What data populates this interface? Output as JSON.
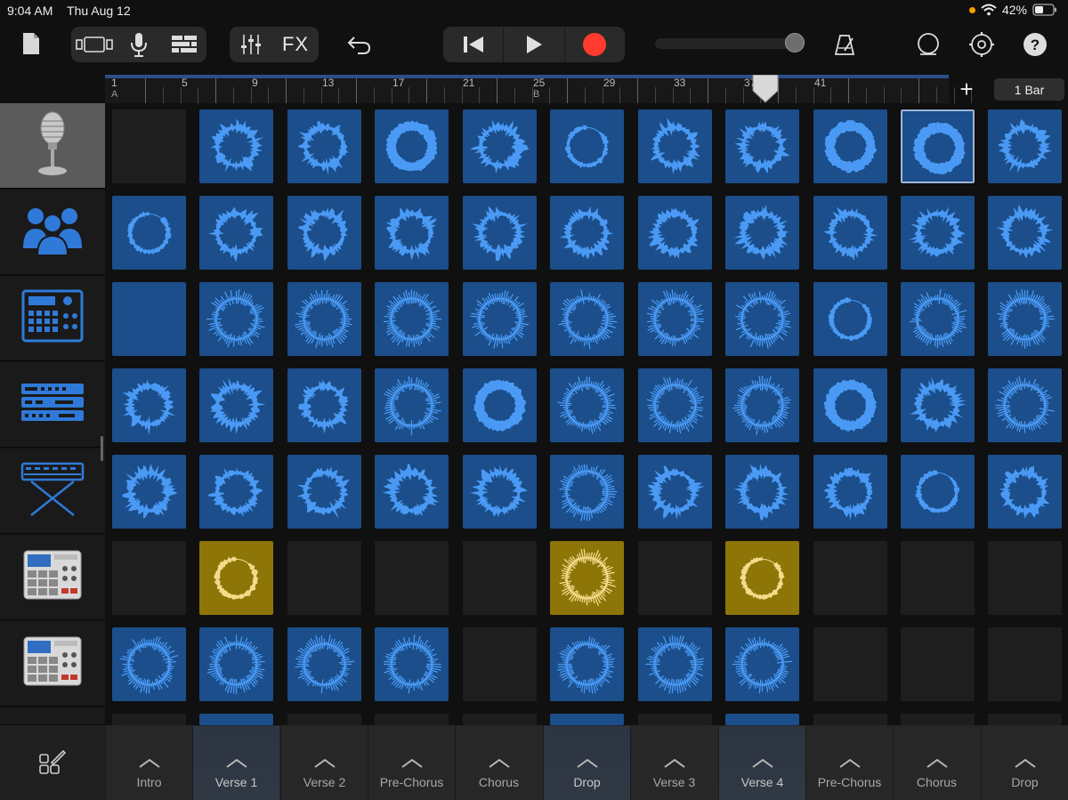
{
  "status": {
    "time": "9:04 AM",
    "date": "Thu Aug 12",
    "battery": "42%"
  },
  "toolbar": {
    "fx_label": "FX",
    "icons": [
      "document-icon",
      "view-toggle-icon",
      "microphone-icon",
      "tracks-view-icon",
      "mixer-icon",
      "undo-icon",
      "rewind-icon",
      "play-icon",
      "record-icon",
      "metronome-icon",
      "loop-icon",
      "settings-icon",
      "help-icon"
    ],
    "colors": {
      "record": "#ff3b30",
      "accent": "#2a6fdb"
    }
  },
  "ruler": {
    "bars": [
      "1",
      "5",
      "9",
      "13",
      "17",
      "21",
      "25",
      "29",
      "33",
      "37",
      "41"
    ],
    "markers": [
      {
        "bar": "1",
        "letter": "A"
      },
      {
        "bar": "25",
        "letter": "B"
      }
    ],
    "playhead_bar": "33"
  },
  "bar_length_label": "1 Bar",
  "tracks": [
    {
      "icon": "vintage-microphone-icon",
      "selected": true,
      "cells": [
        "empty",
        "blue",
        "blue",
        "blue",
        "blue",
        "blue",
        "blue",
        "blue",
        "blue",
        "blue",
        "blue"
      ],
      "wave": [
        0,
        0,
        0,
        1,
        0,
        2,
        0,
        0,
        1,
        1,
        0
      ]
    },
    {
      "icon": "singers-icon",
      "selected": false,
      "cells": [
        "blue",
        "blue",
        "blue",
        "blue",
        "blue",
        "blue",
        "blue",
        "blue",
        "blue",
        "blue",
        "blue"
      ],
      "wave": [
        2,
        0,
        0,
        0,
        0,
        0,
        0,
        0,
        0,
        0,
        0
      ]
    },
    {
      "icon": "drum-machine-icon",
      "selected": false,
      "cells": [
        "blue",
        "blue",
        "blue",
        "blue",
        "blue",
        "blue",
        "blue",
        "blue",
        "blue",
        "blue",
        "blue"
      ],
      "wave": [
        3,
        4,
        4,
        4,
        4,
        4,
        4,
        4,
        2,
        4,
        4
      ]
    },
    {
      "icon": "synth-rack-icon",
      "selected": false,
      "cells": [
        "blue",
        "blue",
        "blue",
        "blue",
        "blue",
        "blue",
        "blue",
        "blue",
        "blue",
        "blue",
        "blue"
      ],
      "wave": [
        0,
        0,
        0,
        4,
        1,
        4,
        4,
        4,
        1,
        0,
        4
      ]
    },
    {
      "icon": "keyboard-stand-icon",
      "selected": false,
      "cells": [
        "blue",
        "blue",
        "blue",
        "blue",
        "blue",
        "blue",
        "blue",
        "blue",
        "blue",
        "blue",
        "blue"
      ],
      "wave": [
        0,
        0,
        0,
        0,
        0,
        4,
        0,
        0,
        0,
        2,
        0
      ]
    },
    {
      "icon": "sampler-icon",
      "selected": false,
      "cells": [
        "empty",
        "gold",
        "empty",
        "empty",
        "empty",
        "gold",
        "empty",
        "gold",
        "empty",
        "empty",
        "empty"
      ],
      "wave": [
        3,
        2,
        3,
        3,
        3,
        4,
        3,
        2,
        3,
        3,
        3
      ]
    },
    {
      "icon": "sampler-icon",
      "selected": false,
      "cells": [
        "blue",
        "blue",
        "blue",
        "blue",
        "empty",
        "blue",
        "blue",
        "blue",
        "empty",
        "empty",
        "empty"
      ],
      "wave": [
        4,
        4,
        4,
        4,
        3,
        4,
        4,
        4,
        3,
        3,
        3
      ]
    }
  ],
  "selected_cell": {
    "row": 0,
    "col": 9
  },
  "partial_row_cells": [
    "empty",
    "blue",
    "empty",
    "empty",
    "empty",
    "blue",
    "empty",
    "blue",
    "empty",
    "empty",
    "empty"
  ],
  "sections": [
    {
      "label": "Intro",
      "playing": false
    },
    {
      "label": "Verse 1",
      "playing": true
    },
    {
      "label": "Verse 2",
      "playing": false
    },
    {
      "label": "Pre-Chorus",
      "playing": false
    },
    {
      "label": "Chorus",
      "playing": false
    },
    {
      "label": "Drop",
      "playing": true
    },
    {
      "label": "Verse 3",
      "playing": false
    },
    {
      "label": "Verse 4",
      "playing": true
    },
    {
      "label": "Pre-Chorus",
      "playing": false
    },
    {
      "label": "Chorus",
      "playing": false
    },
    {
      "label": "Drop",
      "playing": false
    }
  ]
}
